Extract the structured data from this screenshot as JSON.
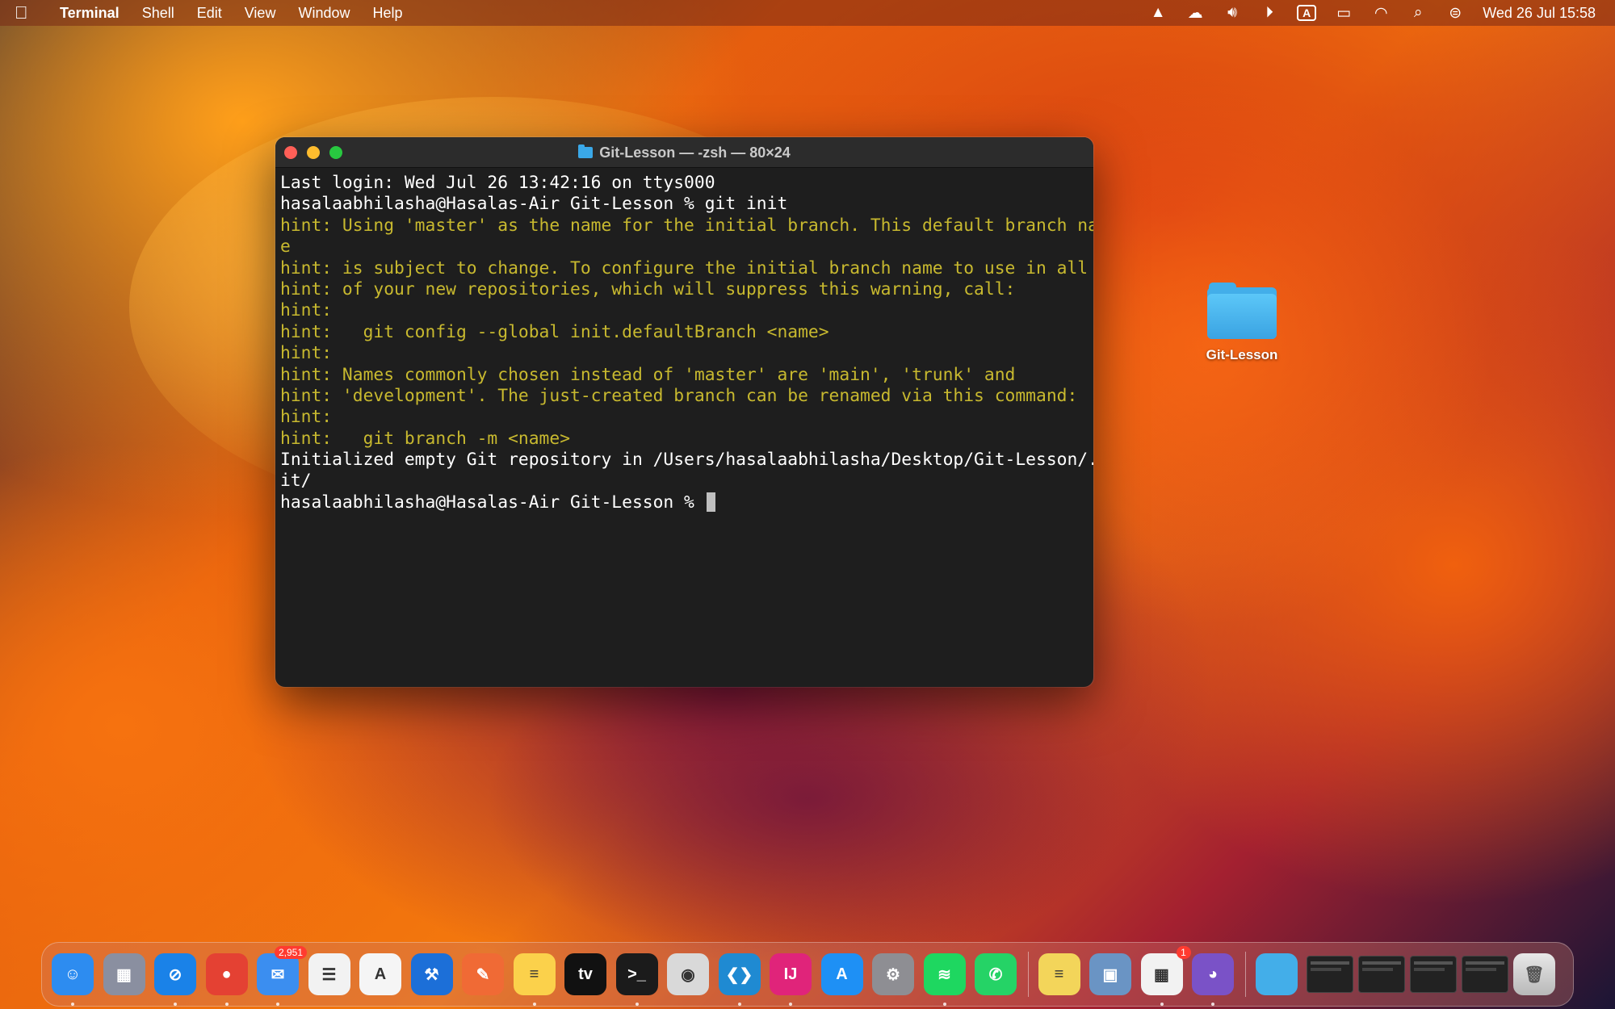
{
  "menubar": {
    "app_name": "Terminal",
    "menus": [
      "Shell",
      "Edit",
      "View",
      "Window",
      "Help"
    ],
    "status_icons": [
      "google-drive-icon",
      "creative-cloud-icon",
      "volume-icon",
      "play-icon",
      "input-source-icon",
      "battery-charging-icon",
      "wifi-icon",
      "spotlight-icon",
      "control-center-icon"
    ],
    "input_source": "A",
    "clock": "Wed 26 Jul  15:58"
  },
  "terminal": {
    "title": "Git-Lesson — -zsh — 80×24",
    "lines": [
      {
        "text": "Last login: Wed Jul 26 13:42:16 on ttys000",
        "type": "normal"
      },
      {
        "text": "hasalaabhilasha@Hasalas-Air Git-Lesson % git init",
        "type": "normal"
      },
      {
        "text": "hint: Using 'master' as the name for the initial branch. This default branch nam",
        "type": "hint"
      },
      {
        "text": "e",
        "type": "hint"
      },
      {
        "text": "hint: is subject to change. To configure the initial branch name to use in all",
        "type": "hint"
      },
      {
        "text": "hint: of your new repositories, which will suppress this warning, call:",
        "type": "hint"
      },
      {
        "text": "hint:",
        "type": "hint"
      },
      {
        "text": "hint:   git config --global init.defaultBranch <name>",
        "type": "hint"
      },
      {
        "text": "hint:",
        "type": "hint"
      },
      {
        "text": "hint: Names commonly chosen instead of 'master' are 'main', 'trunk' and",
        "type": "hint"
      },
      {
        "text": "hint: 'development'. The just-created branch can be renamed via this command:",
        "type": "hint"
      },
      {
        "text": "hint:",
        "type": "hint"
      },
      {
        "text": "hint:   git branch -m <name>",
        "type": "hint"
      },
      {
        "text": "Initialized empty Git repository in /Users/hasalaabhilasha/Desktop/Git-Lesson/.g",
        "type": "normal"
      },
      {
        "text": "it/",
        "type": "normal"
      },
      {
        "text": "hasalaabhilasha@Hasalas-Air Git-Lesson % ",
        "type": "prompt"
      }
    ]
  },
  "desktop": {
    "folder_label": "Git-Lesson"
  },
  "dock": {
    "apps": [
      {
        "name": "finder",
        "glyph": "☺",
        "color": "#2d8cf0",
        "running": true
      },
      {
        "name": "launchpad",
        "glyph": "▦",
        "color": "#8a8fa0",
        "running": false
      },
      {
        "name": "safari",
        "glyph": "⊘",
        "color": "#1a82e8",
        "running": true
      },
      {
        "name": "chrome",
        "glyph": "●",
        "color": "#e44133",
        "running": true
      },
      {
        "name": "mail",
        "glyph": "✉",
        "color": "#3b8ef0",
        "running": true,
        "badge": "2,951"
      },
      {
        "name": "reminders",
        "glyph": "☰",
        "color": "#f2f2f2",
        "running": false
      },
      {
        "name": "instruments",
        "glyph": "A",
        "color": "#f5f5f5",
        "running": false
      },
      {
        "name": "xcode",
        "glyph": "⚒",
        "color": "#1c6fd8",
        "running": false
      },
      {
        "name": "postman",
        "glyph": "✎",
        "color": "#f06a35",
        "running": false
      },
      {
        "name": "notes",
        "glyph": "≡",
        "color": "#fbd14b",
        "running": true
      },
      {
        "name": "apple-tv",
        "glyph": "tv",
        "color": "#111111",
        "running": false
      },
      {
        "name": "terminal",
        "glyph": ">_",
        "color": "#1b1b1b",
        "running": true
      },
      {
        "name": "screenshot",
        "glyph": "◉",
        "color": "#d9d9d9",
        "running": false
      },
      {
        "name": "vscode",
        "glyph": "❮❯",
        "color": "#1f8ad2",
        "running": true
      },
      {
        "name": "intellij",
        "glyph": "IJ",
        "color": "#e0247a",
        "running": true
      },
      {
        "name": "app-store",
        "glyph": "A",
        "color": "#1e90f5",
        "running": false
      },
      {
        "name": "system-settings",
        "glyph": "⚙",
        "color": "#8e8e93",
        "running": false
      },
      {
        "name": "spotify",
        "glyph": "≋",
        "color": "#1ed760",
        "running": true
      },
      {
        "name": "whatsapp",
        "glyph": "✆",
        "color": "#25d366",
        "running": false
      }
    ],
    "apps2": [
      {
        "name": "stickies",
        "glyph": "≡",
        "color": "#f3d55a",
        "running": false
      },
      {
        "name": "preview",
        "glyph": "▣",
        "color": "#6a94c4",
        "running": false
      },
      {
        "name": "office",
        "glyph": "▦",
        "color": "#f2f2f2",
        "running": true,
        "badge": "1"
      },
      {
        "name": "github-desktop",
        "glyph": "◕",
        "color": "#7a52c7",
        "running": true
      }
    ]
  }
}
